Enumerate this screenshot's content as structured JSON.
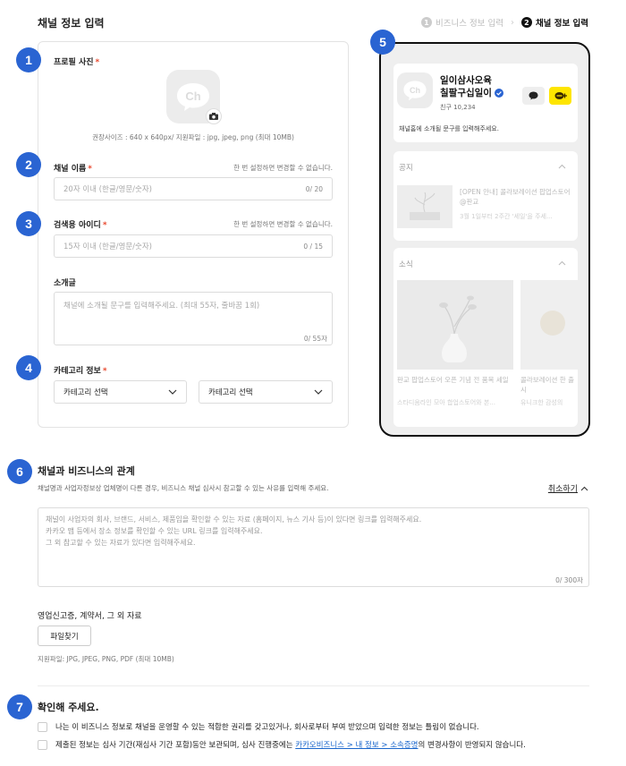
{
  "header": {
    "title": "채널 정보 입력",
    "steps": [
      {
        "num": "1",
        "label": "비즈니스 정보 입력"
      },
      {
        "num": "2",
        "label": "채널 정보 입력"
      }
    ]
  },
  "badges": [
    "1",
    "2",
    "3",
    "4",
    "5",
    "6",
    "7"
  ],
  "form": {
    "profile": {
      "label": "프로필 사진",
      "required": "*",
      "avatar_text": "Ch",
      "hint": "권장사이즈 : 640 x 640px/ 지원파일 : jpg, jpeg, png (최대 10MB)"
    },
    "channel_name": {
      "label": "채널 이름",
      "required": "*",
      "note": "한 번 설정하면 변경할 수 없습니다.",
      "placeholder": "20자 이내 (한글/영문/숫자)",
      "counter": "0/ 20"
    },
    "search_id": {
      "label": "검색용 아이디",
      "required": "*",
      "note": "한 번 설정하면 변경할 수 없습니다.",
      "placeholder": "15자 이내 (한글/영문/숫자)",
      "counter": "0 / 15"
    },
    "intro": {
      "label": "소개글",
      "placeholder": "채널에 소개될 문구를 입력해주세요. (최대 55자, 줄바꿈 1회)",
      "counter": "0/ 55자"
    },
    "category": {
      "label": "카테고리 정보",
      "required": "*",
      "select1": "카테고리 선택",
      "select2": "카테고리 선택"
    }
  },
  "preview": {
    "avatar_text": "Ch",
    "channel_name_line1": "일이삼사오육",
    "channel_name_line2": "칠팔구십일이",
    "friends": "친구 10,234",
    "intro": "채널홈에 소개될 문구를 입력해주세요.",
    "notice_title": "공지",
    "notice_post_title": "[OPEN 안내] 콜라보레이션 팝업스토어 @판교",
    "notice_post_sub": "3월 1일부터 2주간 '세일'을 주세...",
    "news_title": "소식",
    "news_items": [
      {
        "title": "판교 팝업스토어 오픈 기념 전 품목 세일",
        "sub": "스타디움라인 모아 합업스토어와 본..."
      },
      {
        "title": "콜라보레이션 한 출시",
        "sub": "유니크한 감성의"
      }
    ]
  },
  "relation": {
    "title": "채널과 비즈니스의 관계",
    "desc": "채널명과 사업자정보상 업체명이 다른 경우, 비즈니스 채널 심사시 참고할 수 있는 사유를 입력해 주세요.",
    "cancel": "취소하기",
    "placeholder_lines": [
      "채널이 사업자의 회사, 브랜드, 서비스, 제품임을 확인할 수 있는 자료 (홈페이지, 뉴스 기사 등)이 있다면 링크를 입력해주세요.",
      "카카오 맵 등에서 장소 정보를 확인할 수 있는 URL 링크를 입력해주세요.",
      "그 외 참고할 수 있는 자료가 있다면 입력해주세요."
    ],
    "counter": "0/ 300자",
    "docs_label": "영업신고증, 계약서, 그 외 자료",
    "file_button": "파일찾기",
    "file_hint": "지원파일: JPG, JPEG, PNG, PDF (최대 10MB)"
  },
  "confirm": {
    "title": "확인해 주세요.",
    "check1": "나는 이 비즈니스 정보로 채널을 운영할 수 있는 적합한 권리를 갖고있거나, 회사로부터 부여 받았으며 입력한 정보는 틀림이 없습니다.",
    "check2_pre": "제출된 정보는 심사 기간(재심사 기간 포함)동안 보관되며, 심사 진행중에는 ",
    "check2_link": "카카오비즈니스 > 내 정보 > 소속증명",
    "check2_post": "의 변경사항이 반영되지 않습니다."
  },
  "colors": {
    "badge": "#2a64d2",
    "required": "#e8472c",
    "kakao_yellow": "#fee500",
    "link": "#1a66cc"
  }
}
